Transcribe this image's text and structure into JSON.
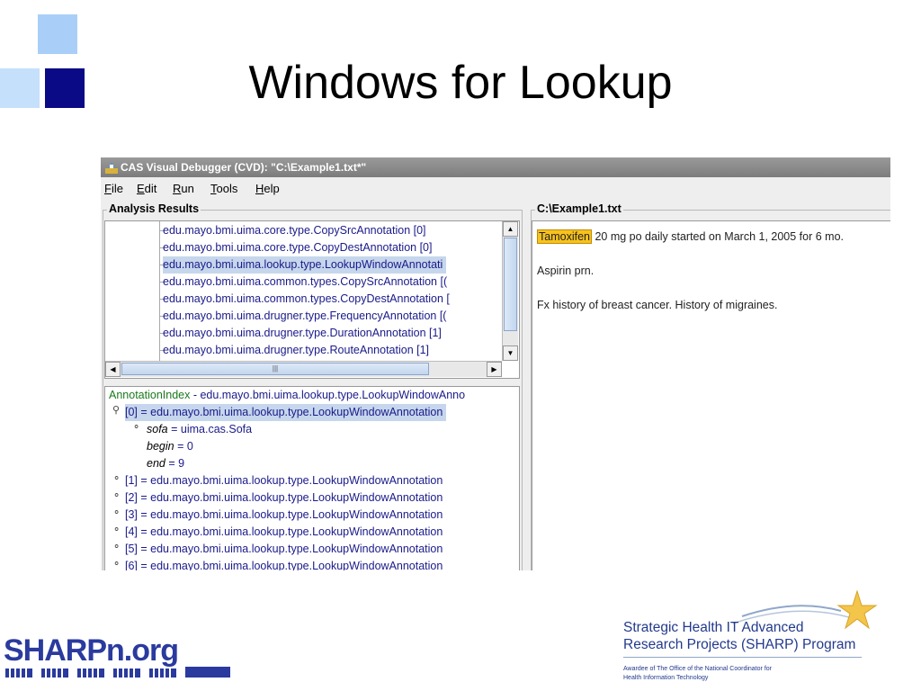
{
  "slide": {
    "title": "Windows for Lookup"
  },
  "window": {
    "title": "CAS Visual Debugger (CVD): \"C:\\Example1.txt*\"",
    "menus": [
      {
        "label": "File",
        "hotkey": "F",
        "rest": "ile"
      },
      {
        "label": "Edit",
        "hotkey": "E",
        "rest": "dit"
      },
      {
        "label": "Run",
        "hotkey": "R",
        "rest": "un"
      },
      {
        "label": "Tools",
        "hotkey": "T",
        "rest": "ools"
      },
      {
        "label": "Help",
        "hotkey": "H",
        "rest": "elp"
      }
    ]
  },
  "analysis": {
    "title": "Analysis Results",
    "rows": [
      "edu.mayo.bmi.uima.core.type.CopySrcAnnotation [0]",
      "edu.mayo.bmi.uima.core.type.CopyDestAnnotation [0]",
      "edu.mayo.bmi.uima.lookup.type.LookupWindowAnnotati",
      "edu.mayo.bmi.uima.common.types.CopySrcAnnotation [(",
      "edu.mayo.bmi.uima.common.types.CopyDestAnnotation [",
      "edu.mayo.bmi.uima.drugner.type.FrequencyAnnotation [(",
      "edu.mayo.bmi.uima.drugner.type.DurationAnnotation [1]",
      "edu.mayo.bmi.uima.drugner.type.RouteAnnotation [1]"
    ],
    "selected_index": 2
  },
  "index": {
    "head_label": "AnnotationIndex",
    "head_rest": " - edu.mayo.bmi.uima.lookup.type.LookupWindowAnno",
    "selected": "[0] = edu.mayo.bmi.uima.lookup.type.LookupWindowAnnotation",
    "children": [
      {
        "key": "sofa",
        "value": " = uima.cas.Sofa"
      },
      {
        "key": "begin",
        "value": " = 0"
      },
      {
        "key": "end",
        "value": " = 9"
      }
    ],
    "items": [
      "[1] = edu.mayo.bmi.uima.lookup.type.LookupWindowAnnotation",
      "[2] = edu.mayo.bmi.uima.lookup.type.LookupWindowAnnotation",
      "[3] = edu.mayo.bmi.uima.lookup.type.LookupWindowAnnotation",
      "[4] = edu.mayo.bmi.uima.lookup.type.LookupWindowAnnotation",
      "[5] = edu.mayo.bmi.uima.lookup.type.LookupWindowAnnotation",
      "[6] = edu.mayo.bmi.uima.lookup.type.LookupWindowAnnotation"
    ]
  },
  "document": {
    "title": "C:\\Example1.txt",
    "highlight": "Tamoxifen",
    "line1_rest": " 20 mg po daily started on March 1, 2005 for 6 mo.",
    "line2": "Aspirin prn.",
    "line3": "Fx history of breast cancer.  History of migraines."
  },
  "logos": {
    "left_text": "SHARPn.org",
    "right_line1": "Strategic Health IT Advanced",
    "right_line2": "Research Projects (SHARP) Program",
    "right_sub1": "Awardee of The Office of the National Coordinator for",
    "right_sub2": "Health Information Technology"
  },
  "colors": {
    "accent": "#0a0a86",
    "highlight": "#f7c21e",
    "selection": "#c6d6ec"
  }
}
